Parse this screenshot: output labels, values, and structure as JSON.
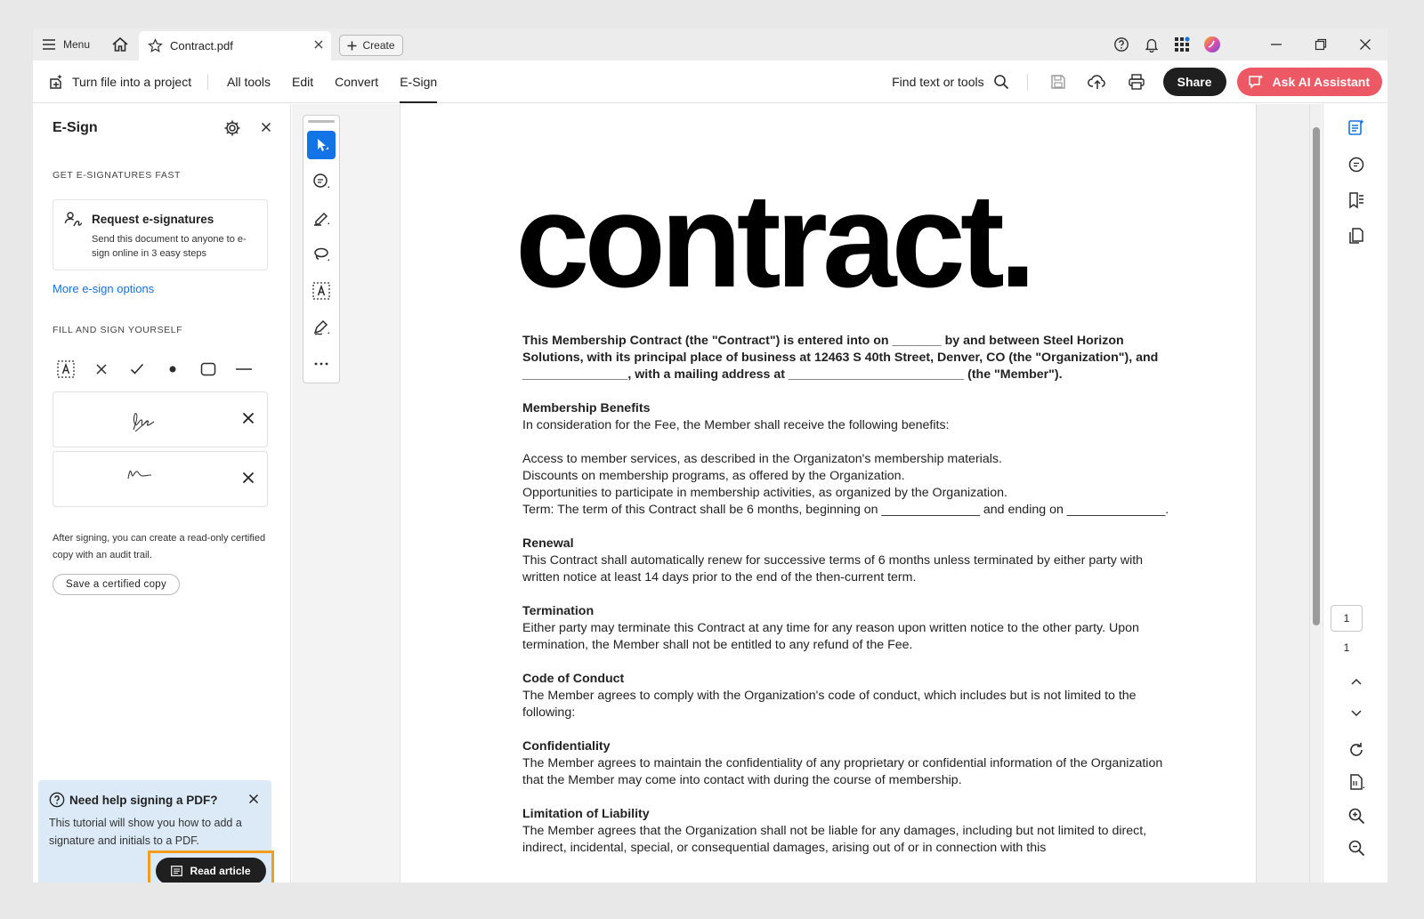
{
  "titlebar": {
    "menu_label": "Menu",
    "tab_title": "Contract.pdf",
    "create_label": "Create"
  },
  "toolbar": {
    "project_label": "Turn file into a project",
    "nav": [
      "All tools",
      "Edit",
      "Convert",
      "E-Sign"
    ],
    "active_nav": "E-Sign",
    "find_label": "Find text or tools",
    "share_label": "Share",
    "ai_label": "Ask AI Assistant"
  },
  "esign_panel": {
    "title": "E-Sign",
    "section_fast": "GET E-SIGNATURES FAST",
    "request_title": "Request e-signatures",
    "request_desc": "Send this document to anyone to e-sign online in 3 easy steps",
    "more_options": "More e-sign options",
    "section_fill": "FILL AND SIGN YOURSELF",
    "fill_tools": [
      "text-field-icon",
      "cross-mark-icon",
      "check-mark-icon",
      "dot-icon",
      "rounded-rect-icon",
      "line-icon"
    ],
    "note": "After signing, you can create a read-only certified copy with an audit trail.",
    "certified_button": "Save a certified copy"
  },
  "help_card": {
    "title": "Need help signing a PDF?",
    "desc": "This tutorial will show you how to add a signature and initials to a PDF.",
    "button": "Read article"
  },
  "document": {
    "heading": "contract.",
    "intro": "This Membership Contract (the \"Contract\") is entered into on _______ by and between Steel Horizon Solutions, with its principal place of business at 12463 S 40th Street, Denver, CO (the \"Organization\"), and _______________, with a mailing address at _________________________ (the \"Member\").",
    "benefits_title": "Membership Benefits",
    "benefits_intro": "In consideration for the Fee, the Member shall receive the following benefits:",
    "benefits_items": [
      "Access to member services, as described in the Organizaton's membership materials.",
      "Discounts on membership programs, as offered by the Organization.",
      "Opportunities to participate in membership activities, as organized by the Organization.",
      "Term: The term of this Contract shall be 6 months, beginning on ______________ and ending on ______________."
    ],
    "renewal_title": "Renewal",
    "renewal_text": "This Contract shall automatically renew for successive terms of 6 months unless terminated by either party with written notice at least 14 days prior to the end of the then-current term.",
    "termination_title": "Termination",
    "termination_text": "Either party may terminate this Contract at any time for any reason upon written notice to the other party. Upon termination, the Member shall not be entitled to any refund of the Fee.",
    "conduct_title": "Code of Conduct",
    "conduct_text": "The Member agrees to comply with the Organization's code of conduct, which includes but is not limited to the following:",
    "confidentiality_title": "Confidentiality",
    "confidentiality_text": "The Member agrees to maintain the confidentiality of any proprietary or confidential information of the Organization that the Member may come into contact with during the course of membership.",
    "liability_title": "Limitation of Liability",
    "liability_text": "The Member agrees that the Organization shall not be liable for any damages, including but not limited to direct, indirect, incidental, special, or consequential damages, arising out of or in connection with this"
  },
  "pager": {
    "current_page": "1",
    "total_pages": "1"
  },
  "colors": {
    "accent": "#1473e6",
    "ai_button": "#ec5863",
    "highlight_frame": "#f39c1f",
    "help_bg": "#dbeaf6"
  }
}
